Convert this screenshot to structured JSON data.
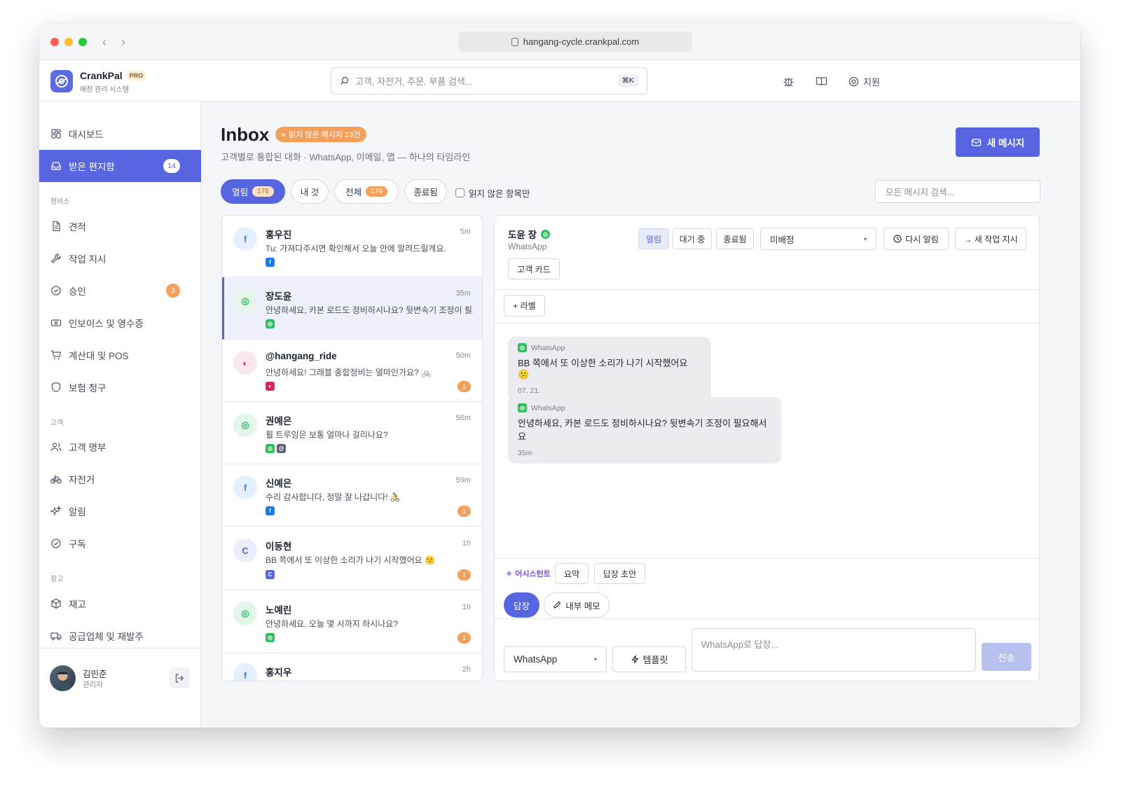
{
  "browser": {
    "url": "hangang-cycle.crankpal.com"
  },
  "app": {
    "name": "CrankPal",
    "tier": "PRO",
    "subtitle": "매장 관리 시스템"
  },
  "search": {
    "placeholder": "고객, 자전거, 주문, 부품 검색...",
    "shortcut": "⌘K"
  },
  "header": {
    "support_label": "지원"
  },
  "sidebar": {
    "top": [
      {
        "label": "대시보드",
        "icon": "dashboard-icon"
      },
      {
        "label": "받은 편지함",
        "icon": "inbox-icon",
        "badge": "14",
        "active": true
      }
    ],
    "sections": [
      {
        "title": "정비소",
        "items": [
          {
            "label": "견적",
            "icon": "document-icon"
          },
          {
            "label": "작업 지시",
            "icon": "wrench-icon"
          },
          {
            "label": "승인",
            "icon": "check-circle-icon",
            "badge": "3"
          },
          {
            "label": "인보이스 및 영수증",
            "icon": "receipt-icon"
          },
          {
            "label": "계산대 및 POS",
            "icon": "cart-icon"
          },
          {
            "label": "보험 청구",
            "icon": "shield-icon"
          }
        ]
      },
      {
        "title": "고객",
        "items": [
          {
            "label": "고객 명부",
            "icon": "users-icon"
          },
          {
            "label": "자전거",
            "icon": "bicycle-icon"
          },
          {
            "label": "알림",
            "icon": "sparkle-icon"
          },
          {
            "label": "구독",
            "icon": "check-circle-icon"
          }
        ]
      },
      {
        "title": "창고",
        "items": [
          {
            "label": "재고",
            "icon": "box-icon"
          },
          {
            "label": "공급업체 및 재발주",
            "icon": "truck-icon"
          }
        ]
      }
    ],
    "user": {
      "name": "김민준",
      "role": "관리자"
    }
  },
  "inbox": {
    "title": "Inbox",
    "unread_badge": "읽지 않은 메시지 13건",
    "subtitle": "고객별로 통합된 대화 · WhatsApp, 이메일, 앱 — 하나의 타임라인",
    "new_message": "새 메시지",
    "filters": [
      {
        "label": "열림",
        "count": "176",
        "active": true
      },
      {
        "label": "내 것"
      },
      {
        "label": "전체",
        "count": "176"
      },
      {
        "label": "종료됨"
      }
    ],
    "unread_only": "읽지 않은 항목만",
    "search_placeholder": "모든 메시지 검색..."
  },
  "conversations": [
    {
      "avatar": "f",
      "name": "홍우진",
      "time": "5m",
      "preview": "Tu: 가져다주시면 확인해서 오늘 안에 알려드릴게요.",
      "channels": [
        "facebook"
      ],
      "count": ""
    },
    {
      "avatar": "◎",
      "name": "장도윤",
      "time": "35m",
      "preview": "안녕하세요, 카본 로드도 정비하시나요? 뒷변속기 조정이 필요",
      "channels": [
        "whatsapp"
      ],
      "count": "",
      "selected": true
    },
    {
      "avatar": "◐",
      "name": "@hangang_ride",
      "time": "50m",
      "preview": "안녕하세요! 그래블 종합정비는 얼마인가요? 🚲",
      "channels": [
        "instagram"
      ],
      "count": "1"
    },
    {
      "avatar": "◎",
      "name": "권예은",
      "time": "56m",
      "preview": "휠 트루잉은 보통 얼마나 걸리나요?",
      "channels": [
        "whatsapp",
        "email"
      ],
      "count": ""
    },
    {
      "avatar": "f",
      "name": "신예은",
      "time": "59m",
      "preview": "수리 감사합니다, 정말 잘 나갑니다! 🚴",
      "channels": [
        "facebook"
      ],
      "count": "1"
    },
    {
      "avatar": "C",
      "name": "이동현",
      "time": "1h",
      "preview": "BB 쪽에서 또 이상한 소리가 나기 시작했어요 😕",
      "channels": [
        "app"
      ],
      "count": "1"
    },
    {
      "avatar": "◎",
      "name": "노예린",
      "time": "1h",
      "preview": "안녕하세요, 오늘 몇 시까지 하시나요?",
      "channels": [
        "whatsapp"
      ],
      "count": "1"
    },
    {
      "avatar": "f",
      "name": "홍지우",
      "time": "2h",
      "preview": "",
      "channels": [],
      "count": ""
    }
  ],
  "thread": {
    "contact_name": "도윤 장",
    "channel": "WhatsApp",
    "status_buttons": [
      "열림",
      "대기 중",
      "종료됨"
    ],
    "assignee": "미배정",
    "remind": "다시 알림",
    "new_work_order": "→ 새 작업 지시",
    "customer_card": "고객 카드",
    "add_label": "+ 라벨",
    "messages": [
      {
        "channel": "WhatsApp",
        "text": "BB 쪽에서 또 이상한 소리가 나기 시작했어요 😕",
        "time": "07. 21."
      },
      {
        "channel": "WhatsApp",
        "text": "안녕하세요, 카본 로드도 정비하시나요? 뒷변속기 조정이 필요해서요",
        "time": "35m"
      }
    ],
    "assistant": "어시스턴트",
    "summary": "요약",
    "draft": "답장 초안",
    "reply_tab": "답장",
    "note_tab": "내부 메모",
    "channel_select": "WhatsApp",
    "template": "템플릿",
    "compose_placeholder": "WhatsApp로 답장...",
    "send": "전송"
  },
  "colors": {
    "accent": "#5766e0",
    "orange": "#f5a05a",
    "whatsapp": "#2dbf5c",
    "facebook": "#1877f2",
    "instagram": "#e0245e",
    "app": "#5766e0"
  }
}
